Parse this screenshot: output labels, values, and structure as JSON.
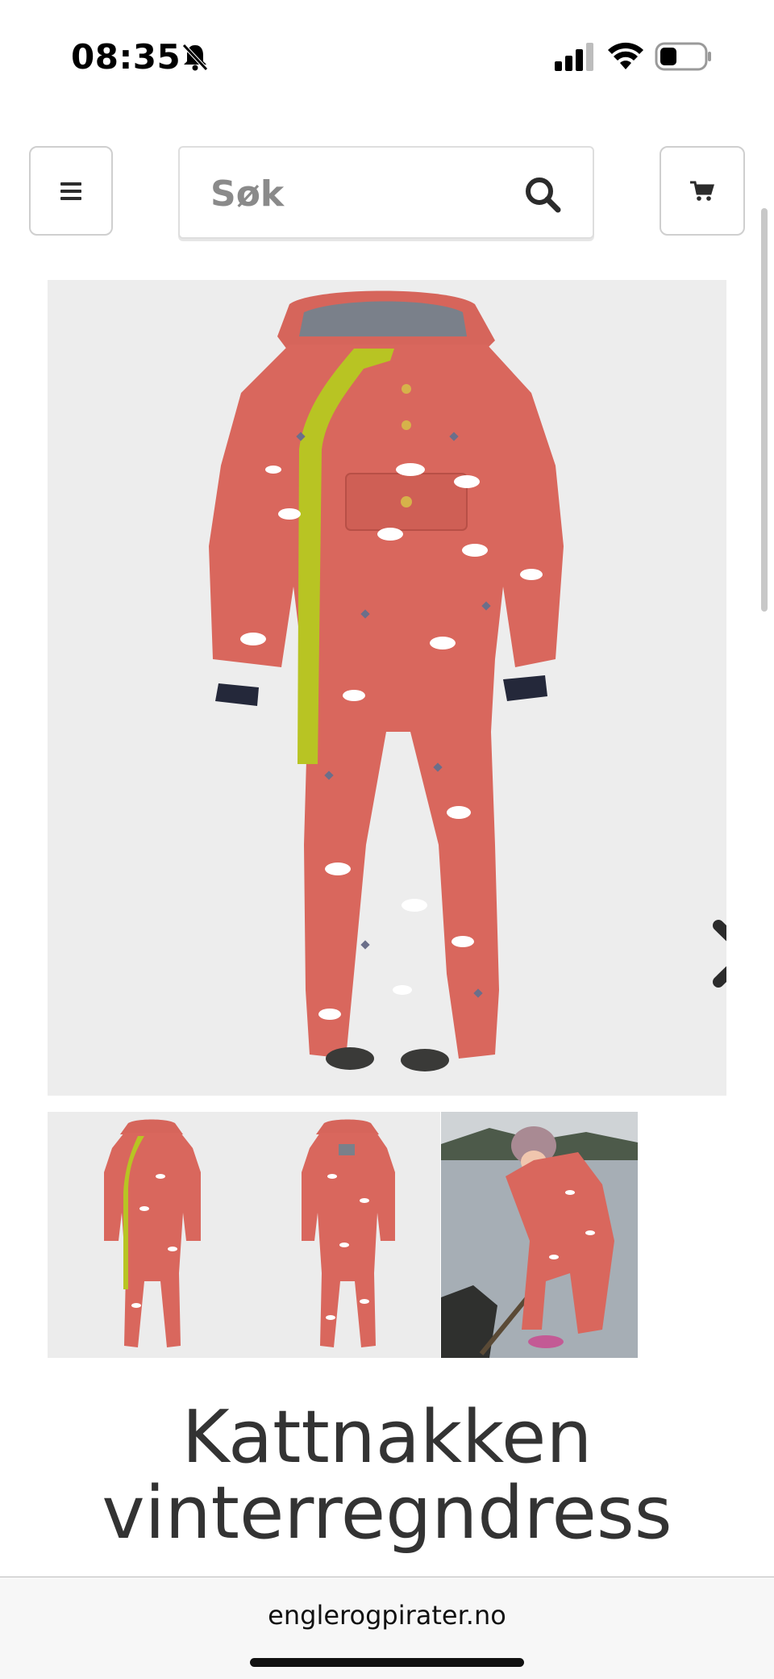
{
  "status_bar": {
    "time": "08:35",
    "icons": [
      "bell-slash-icon",
      "signal-icon",
      "wifi-icon",
      "battery-icon"
    ]
  },
  "header": {
    "menu_icon": "hamburger-menu-icon",
    "search": {
      "placeholder": "Søk",
      "icon": "search-icon"
    },
    "cart_icon": "cart-icon"
  },
  "product": {
    "main_image_alt": "Kattnakken vinterregndress",
    "next_icon": "chevron-right-icon",
    "thumbnails": [
      "front view",
      "back view",
      "child wearing suit by the water"
    ],
    "title_line1": "Kattnakken",
    "title_line2": "vinterregndress"
  },
  "browser": {
    "url": "englerogpirater.no"
  },
  "colors": {
    "suit": "#d9675d",
    "zip": "#b8c423",
    "image_bg": "#ededed",
    "border": "#cfcfcf"
  }
}
